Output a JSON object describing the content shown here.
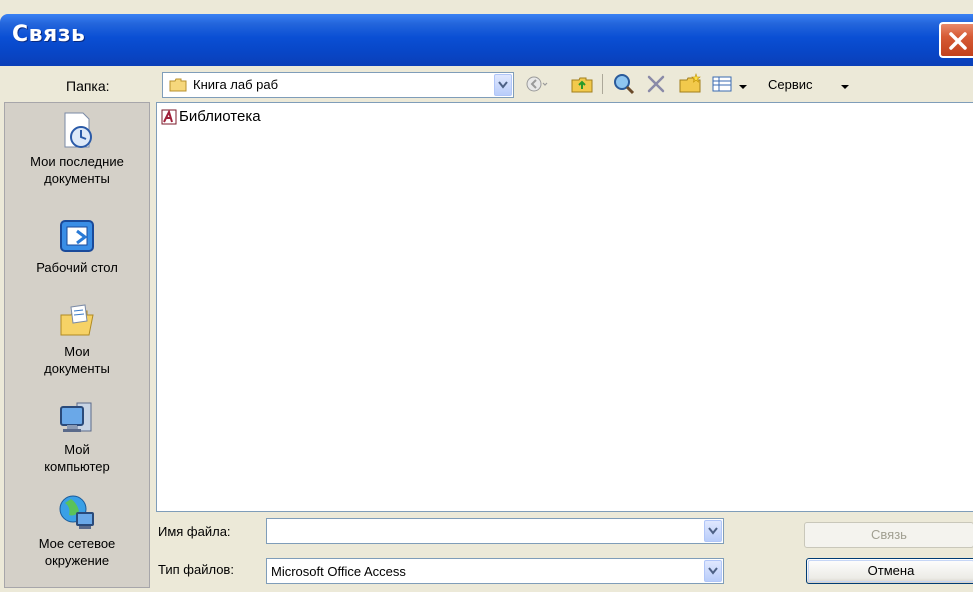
{
  "window": {
    "title": "Связь",
    "close_icon": "close-icon"
  },
  "toolbar": {
    "folder_label": "Папка:",
    "folder_value": "Книга лаб раб",
    "service_label": "Сервис"
  },
  "places": [
    {
      "label": "Мои последние документы",
      "icon": "recent-documents-icon"
    },
    {
      "label": "Рабочий стол",
      "icon": "desktop-icon"
    },
    {
      "label": "Мои документы",
      "icon": "my-documents-icon"
    },
    {
      "label": "Мой компьютер",
      "icon": "my-computer-icon"
    },
    {
      "label": "Мое сетевое окружение",
      "icon": "network-places-icon"
    }
  ],
  "files": [
    {
      "name": "Библиотека",
      "icon": "access-database-icon"
    }
  ],
  "form": {
    "file_name_label": "Имя файла:",
    "file_name_value": "",
    "file_type_label": "Тип файлов:",
    "file_type_value": "Microsoft Office Access"
  },
  "buttons": {
    "link_label": "Связь",
    "cancel_label": "Отмена"
  },
  "colors": {
    "titlebar": "#0a4fd4",
    "dialog_bg": "#ece9d8",
    "close": "#d65a34"
  }
}
